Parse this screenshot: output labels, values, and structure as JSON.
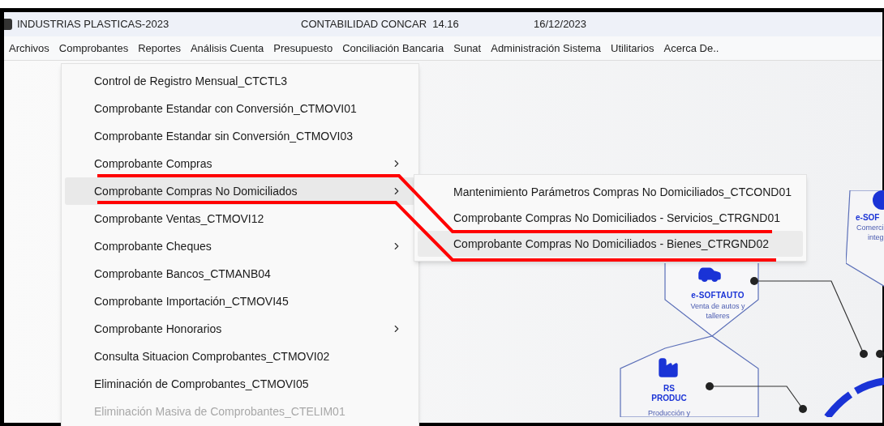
{
  "window": {
    "title": "INDUSTRIAS PLASTICAS-2023",
    "app": "CONTABILIDAD CONCAR  14.16",
    "date": "16/12/2023"
  },
  "menu_bar": [
    "Archivos",
    "Comprobantes",
    "Reportes",
    "Análisis Cuenta",
    "Presupuesto",
    "Conciliación Bancaria",
    "Sunat",
    "Administración Sistema",
    "Utilitarios",
    "Acerca De.."
  ],
  "menu": [
    {
      "label": "Control de Registro Mensual_CTCTL3",
      "submenu": false,
      "selected": false,
      "disabled": false
    },
    {
      "label": "Comprobante Estandar con Conversión_CTMOVI01",
      "submenu": false,
      "selected": false,
      "disabled": false
    },
    {
      "label": "Comprobante Estandar sin Conversión_CTMOVI03",
      "submenu": false,
      "selected": false,
      "disabled": false
    },
    {
      "label": "Comprobante Compras",
      "submenu": true,
      "selected": false,
      "disabled": false
    },
    {
      "label": "Comprobante Compras No Domiciliados",
      "submenu": true,
      "selected": true,
      "disabled": false
    },
    {
      "label": "Comprobante Ventas_CTMOVI12",
      "submenu": false,
      "selected": false,
      "disabled": false
    },
    {
      "label": "Comprobante Cheques",
      "submenu": true,
      "selected": false,
      "disabled": false
    },
    {
      "label": "Comprobante Bancos_CTMANB04",
      "submenu": false,
      "selected": false,
      "disabled": false
    },
    {
      "label": "Comprobante Importación_CTMOVI45",
      "submenu": false,
      "selected": false,
      "disabled": false
    },
    {
      "label": "Comprobante Honorarios",
      "submenu": true,
      "selected": false,
      "disabled": false
    },
    {
      "label": "Consulta Situacion Comprobantes_CTMOVI02",
      "submenu": false,
      "selected": false,
      "disabled": false
    },
    {
      "label": "Eliminación de Comprobantes_CTMOVI05",
      "submenu": false,
      "selected": false,
      "disabled": false
    },
    {
      "label": "Eliminación Masiva de Comprobantes_CTELIM01",
      "submenu": false,
      "selected": false,
      "disabled": true
    }
  ],
  "submenu": [
    {
      "label": "Mantenimiento Parámetros Compras No Domiciliados_CTCOND01",
      "selected": false
    },
    {
      "label": "Comprobante Compras No Domiciliados - Servicios_CTRGND01",
      "selected": false
    },
    {
      "label": "Comprobante Compras No Domiciliados - Bienes_CTRGND02",
      "selected": true
    }
  ],
  "background": {
    "softauto": {
      "name": "e-SOFTAUTO",
      "caption": "Venta de autos y talleres"
    },
    "produc": {
      "name_1": "RS",
      "name_2": "PRODUC",
      "caption": "Producción y"
    },
    "comercial": {
      "name": "e-SOF",
      "caption_1": "Comerci",
      "caption_2": "integ"
    }
  }
}
